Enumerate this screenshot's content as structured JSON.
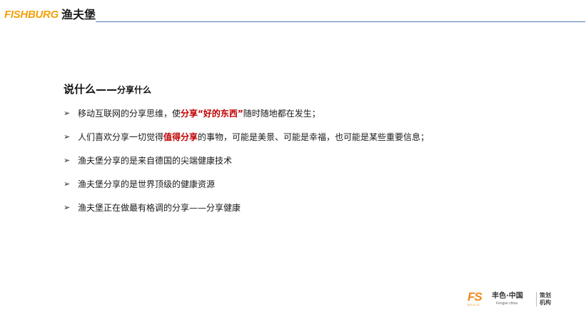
{
  "header": {
    "logo_latin": "FISHBURG",
    "logo_cn": "渔夫堡",
    "rule_color": "#4a7bb7",
    "brand_color": "#f0a10a"
  },
  "heading": {
    "main": "说什么——",
    "sub": "分享什么"
  },
  "bullets": [
    {
      "pre": "移动互联网的分享思维，使",
      "hl": "分享“好的东西”",
      "post": "随时随地都在发生；"
    },
    {
      "pre": "人们喜欢分享一切觉得",
      "hl": "值得分享",
      "post": "的事物，可能是美景、可能是幸福，也可能是某些重要信息；"
    },
    {
      "pre": "渔夫堡分享的是来自德国的尖端健康技术",
      "hl": "",
      "post": ""
    },
    {
      "pre": "渔夫堡分享的是世界顶级的健康资源",
      "hl": "",
      "post": ""
    },
    {
      "pre": "渔夫堡正在做最有格调的分享——分享健康",
      "hl": "",
      "post": ""
    }
  ],
  "bullet_icon": "arrow-right-icon",
  "highlight_color": "#c00000",
  "footer": {
    "mark": "FS",
    "mark_small": "MEDIA",
    "name": "丰色·中国",
    "name_en": "Fengse china",
    "org": "策划机构"
  }
}
